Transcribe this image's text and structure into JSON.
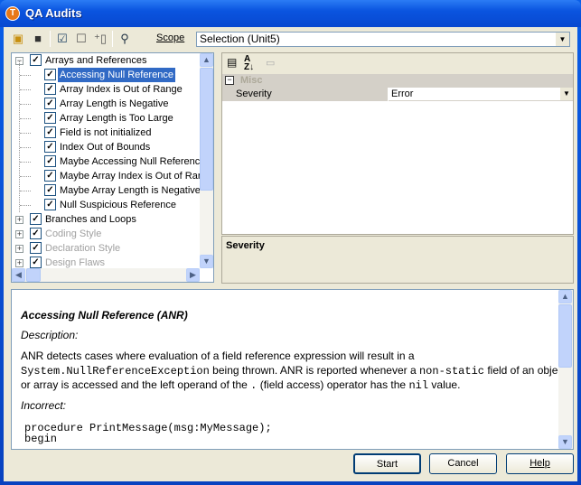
{
  "window": {
    "title": "QA Audits",
    "icon_letter": "T"
  },
  "toolbar": {
    "icons": [
      "open-folder-icon",
      "save-icon",
      "check-all-icon",
      "uncheck-icon",
      "new-audit-icon",
      "find-icon"
    ],
    "scope_label": "Scope",
    "scope_value": "Selection (Unit5)"
  },
  "tree": {
    "items": [
      {
        "label": "Arrays and References",
        "level": 0,
        "expanded": true,
        "checked": true,
        "enabled": true
      },
      {
        "label": "Accessing Null Reference",
        "level": 1,
        "checked": true,
        "selected": true,
        "enabled": true
      },
      {
        "label": "Array Index is Out of Range",
        "level": 1,
        "checked": true,
        "enabled": true
      },
      {
        "label": "Array Length is Negative",
        "level": 1,
        "checked": true,
        "enabled": true
      },
      {
        "label": "Array Length is Too Large",
        "level": 1,
        "checked": true,
        "enabled": true
      },
      {
        "label": "Field is not initialized",
        "level": 1,
        "checked": true,
        "enabled": true
      },
      {
        "label": "Index Out of Bounds",
        "level": 1,
        "checked": true,
        "enabled": true
      },
      {
        "label": "Maybe Accessing Null Reference",
        "level": 1,
        "checked": true,
        "enabled": true
      },
      {
        "label": "Maybe Array Index is Out of Range",
        "level": 1,
        "checked": true,
        "enabled": true
      },
      {
        "label": "Maybe Array Length is Negative",
        "level": 1,
        "checked": true,
        "enabled": true
      },
      {
        "label": "Null Suspicious Reference",
        "level": 1,
        "checked": true,
        "enabled": true
      },
      {
        "label": "Branches and Loops",
        "level": 0,
        "expanded": false,
        "checked": true,
        "enabled": true
      },
      {
        "label": "Coding Style",
        "level": 0,
        "expanded": false,
        "checked": true,
        "enabled": false
      },
      {
        "label": "Declaration Style",
        "level": 0,
        "expanded": false,
        "checked": true,
        "enabled": false
      },
      {
        "label": "Design Flaws",
        "level": 0,
        "expanded": false,
        "checked": true,
        "enabled": false
      }
    ]
  },
  "properties": {
    "category": "Misc",
    "rows": [
      {
        "name": "Severity",
        "value": "Error"
      }
    ],
    "description_title": "Severity"
  },
  "help": {
    "title": "Accessing Null Reference (ANR)",
    "description_label": "Description:",
    "line1": "ANR detects cases where evaluation of a field reference expression will result in a",
    "line2_code1": "System.NullReferenceException",
    "line2_text1": " being thrown. ANR is reported whenever a ",
    "line2_code2": "non-static",
    "line2_text2": " field of an object",
    "line3_text1": "or array is accessed and the left operand of the ",
    "line3_code1": ".",
    "line3_text2": " (field access) operator has the ",
    "line3_code2": "nil",
    "line3_text3": " value.",
    "incorrect_label": "Incorrect:",
    "code": [
      "procedure PrintMessage(msg:MyMessage);",
      "begin"
    ]
  },
  "buttons": {
    "start": "Start",
    "cancel": "Cancel",
    "help": "Help"
  }
}
